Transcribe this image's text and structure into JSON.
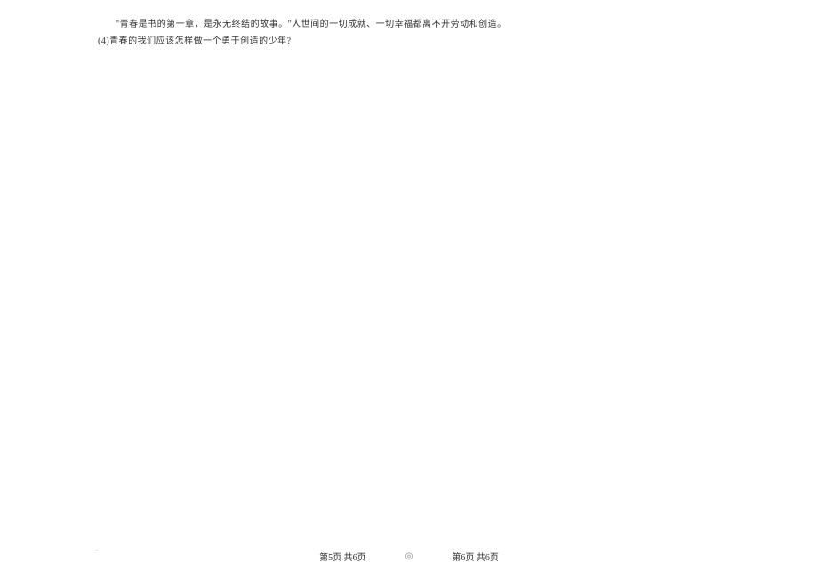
{
  "content": {
    "line1": "\"青春是书的第一章，是永无终结的故事。\"人世间的一切成就、一切幸福都离不开劳动和创造。",
    "line2": "(4)青春的我们应该怎样做一个勇于创造的少年?"
  },
  "footer": {
    "page_left": "第5页 共6页",
    "divider": "◎",
    "page_right": "第6页 共6页"
  },
  "corner": "."
}
